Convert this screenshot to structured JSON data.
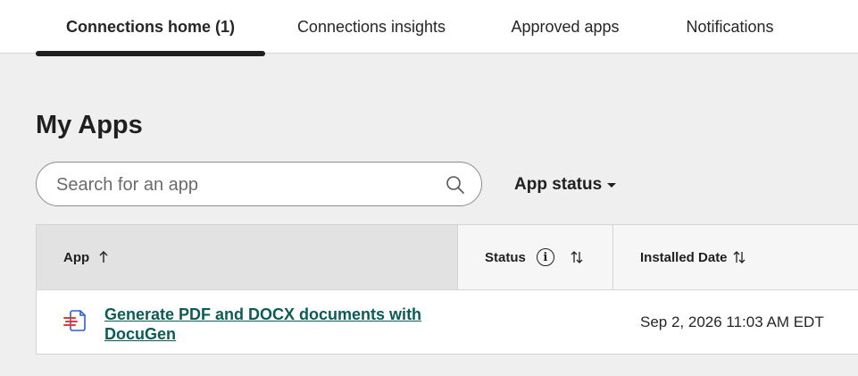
{
  "tabs": [
    {
      "label": "Connections home (1)",
      "active": true
    },
    {
      "label": "Connections insights",
      "active": false
    },
    {
      "label": "Approved apps",
      "active": false
    },
    {
      "label": "Notifications",
      "active": false
    }
  ],
  "page": {
    "title": "My Apps"
  },
  "search": {
    "placeholder": "Search for an app",
    "value": "",
    "icon": "search-icon"
  },
  "filter": {
    "label": "App status",
    "icon": "caret-down-icon"
  },
  "table": {
    "columns": [
      {
        "label": "App",
        "sort": "ascending"
      },
      {
        "label": "Status",
        "info_icon": "i",
        "sort": "none"
      },
      {
        "label": "Installed Date",
        "sort": "none"
      }
    ],
    "rows": [
      {
        "app_name": "Generate PDF and DOCX documents with DocuGen",
        "icon": "document-generator-icon",
        "status": "",
        "installed": "Sep 2, 2026 11:03 AM EDT"
      }
    ]
  },
  "colors": {
    "link": "#0b5b57",
    "active_underline": "#1f1f1f",
    "page_background": "#efefef"
  }
}
